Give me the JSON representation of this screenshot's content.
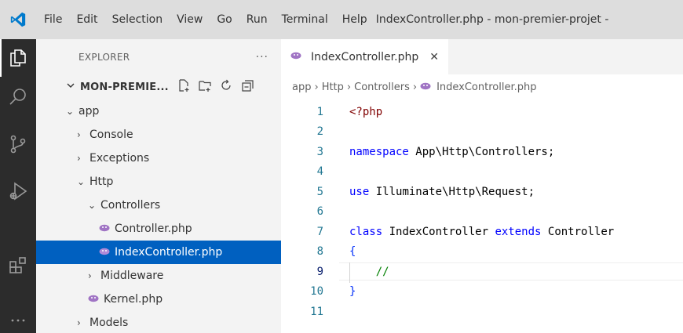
{
  "titlebar": {
    "menu": [
      "File",
      "Edit",
      "Selection",
      "View",
      "Go",
      "Run",
      "Terminal",
      "Help"
    ],
    "window_title": "IndexController.php - mon-premier-projet -"
  },
  "activitybar": {
    "items": [
      "explorer-icon",
      "search-icon",
      "source-control-icon",
      "run-debug-icon",
      "extensions-icon",
      "more-icon"
    ]
  },
  "sidebar": {
    "title": "EXPLORER",
    "more": "···",
    "folder": "MON-PREMIE...",
    "tree": [
      {
        "label": "app",
        "chevron": "⌄",
        "indent": 0
      },
      {
        "label": "Console",
        "chevron": "›",
        "indent": 1
      },
      {
        "label": "Exceptions",
        "chevron": "›",
        "indent": 1
      },
      {
        "label": "Http",
        "chevron": "⌄",
        "indent": 1
      },
      {
        "label": "Controllers",
        "chevron": "⌄",
        "indent": 2
      },
      {
        "label": "Controller.php",
        "chevron": "",
        "indent": 3,
        "php": true
      },
      {
        "label": "IndexController.php",
        "chevron": "",
        "indent": 3,
        "php": true,
        "selected": true
      },
      {
        "label": "Middleware",
        "chevron": "›",
        "indent": 2
      },
      {
        "label": "Kernel.php",
        "chevron": "",
        "indent": 2,
        "php": true
      },
      {
        "label": "Models",
        "chevron": "›",
        "indent": 1
      }
    ]
  },
  "editor": {
    "tab": {
      "label": "IndexController.php",
      "close": "✕"
    },
    "breadcrumb": [
      "app",
      "Http",
      "Controllers",
      "IndexController.php"
    ],
    "current_line": 9,
    "lines": [
      {
        "n": "1",
        "tokens": [
          {
            "t": "<?php",
            "c": "php"
          }
        ]
      },
      {
        "n": "2",
        "tokens": []
      },
      {
        "n": "3",
        "tokens": [
          {
            "t": "namespace",
            "c": "kw"
          },
          {
            "t": " App\\Http\\Controllers;",
            "c": ""
          }
        ]
      },
      {
        "n": "4",
        "tokens": []
      },
      {
        "n": "5",
        "tokens": [
          {
            "t": "use",
            "c": "kw"
          },
          {
            "t": " Illuminate\\Http\\Request;",
            "c": ""
          }
        ]
      },
      {
        "n": "6",
        "tokens": []
      },
      {
        "n": "7",
        "tokens": [
          {
            "t": "class",
            "c": "kw"
          },
          {
            "t": " IndexController ",
            "c": ""
          },
          {
            "t": "extends",
            "c": "kw"
          },
          {
            "t": " Controller",
            "c": ""
          }
        ]
      },
      {
        "n": "8",
        "tokens": [
          {
            "t": "{",
            "c": "brace"
          }
        ]
      },
      {
        "n": "9",
        "tokens": [
          {
            "t": "    //",
            "c": "cmt"
          }
        ]
      },
      {
        "n": "10",
        "tokens": [
          {
            "t": "}",
            "c": "brace"
          }
        ]
      },
      {
        "n": "11",
        "tokens": []
      }
    ]
  },
  "colors": {
    "accent": "#0060c0",
    "activitybar": "#2c2c2c",
    "titlebar": "#dddddd",
    "logo": "#007acc",
    "php_icon": "#a074c4"
  }
}
